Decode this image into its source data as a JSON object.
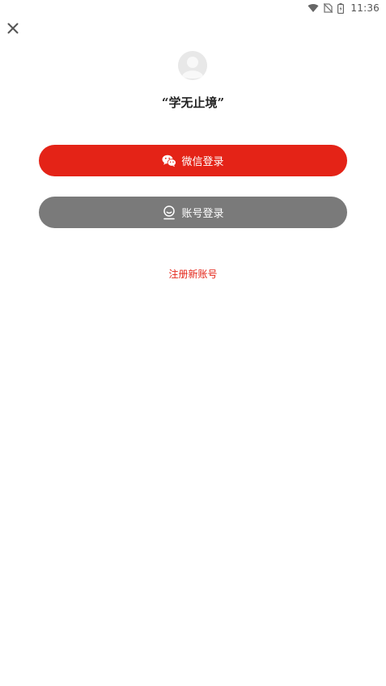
{
  "status_bar": {
    "time": "11:36",
    "icons": [
      "wifi-icon",
      "no-sim-icon",
      "battery-icon"
    ]
  },
  "header": {
    "close_icon": "close-icon"
  },
  "profile": {
    "avatar_icon": "default-avatar-icon",
    "tagline": "“学无止境”"
  },
  "login": {
    "wechat_label": "微信登录",
    "wechat_icon": "wechat-icon",
    "account_label": "账号登录",
    "account_icon": "account-icon",
    "register_label": "注册新账号"
  },
  "colors": {
    "accent": "#e42317",
    "secondary_button": "#7a7a7a",
    "background": "#ffffff"
  }
}
